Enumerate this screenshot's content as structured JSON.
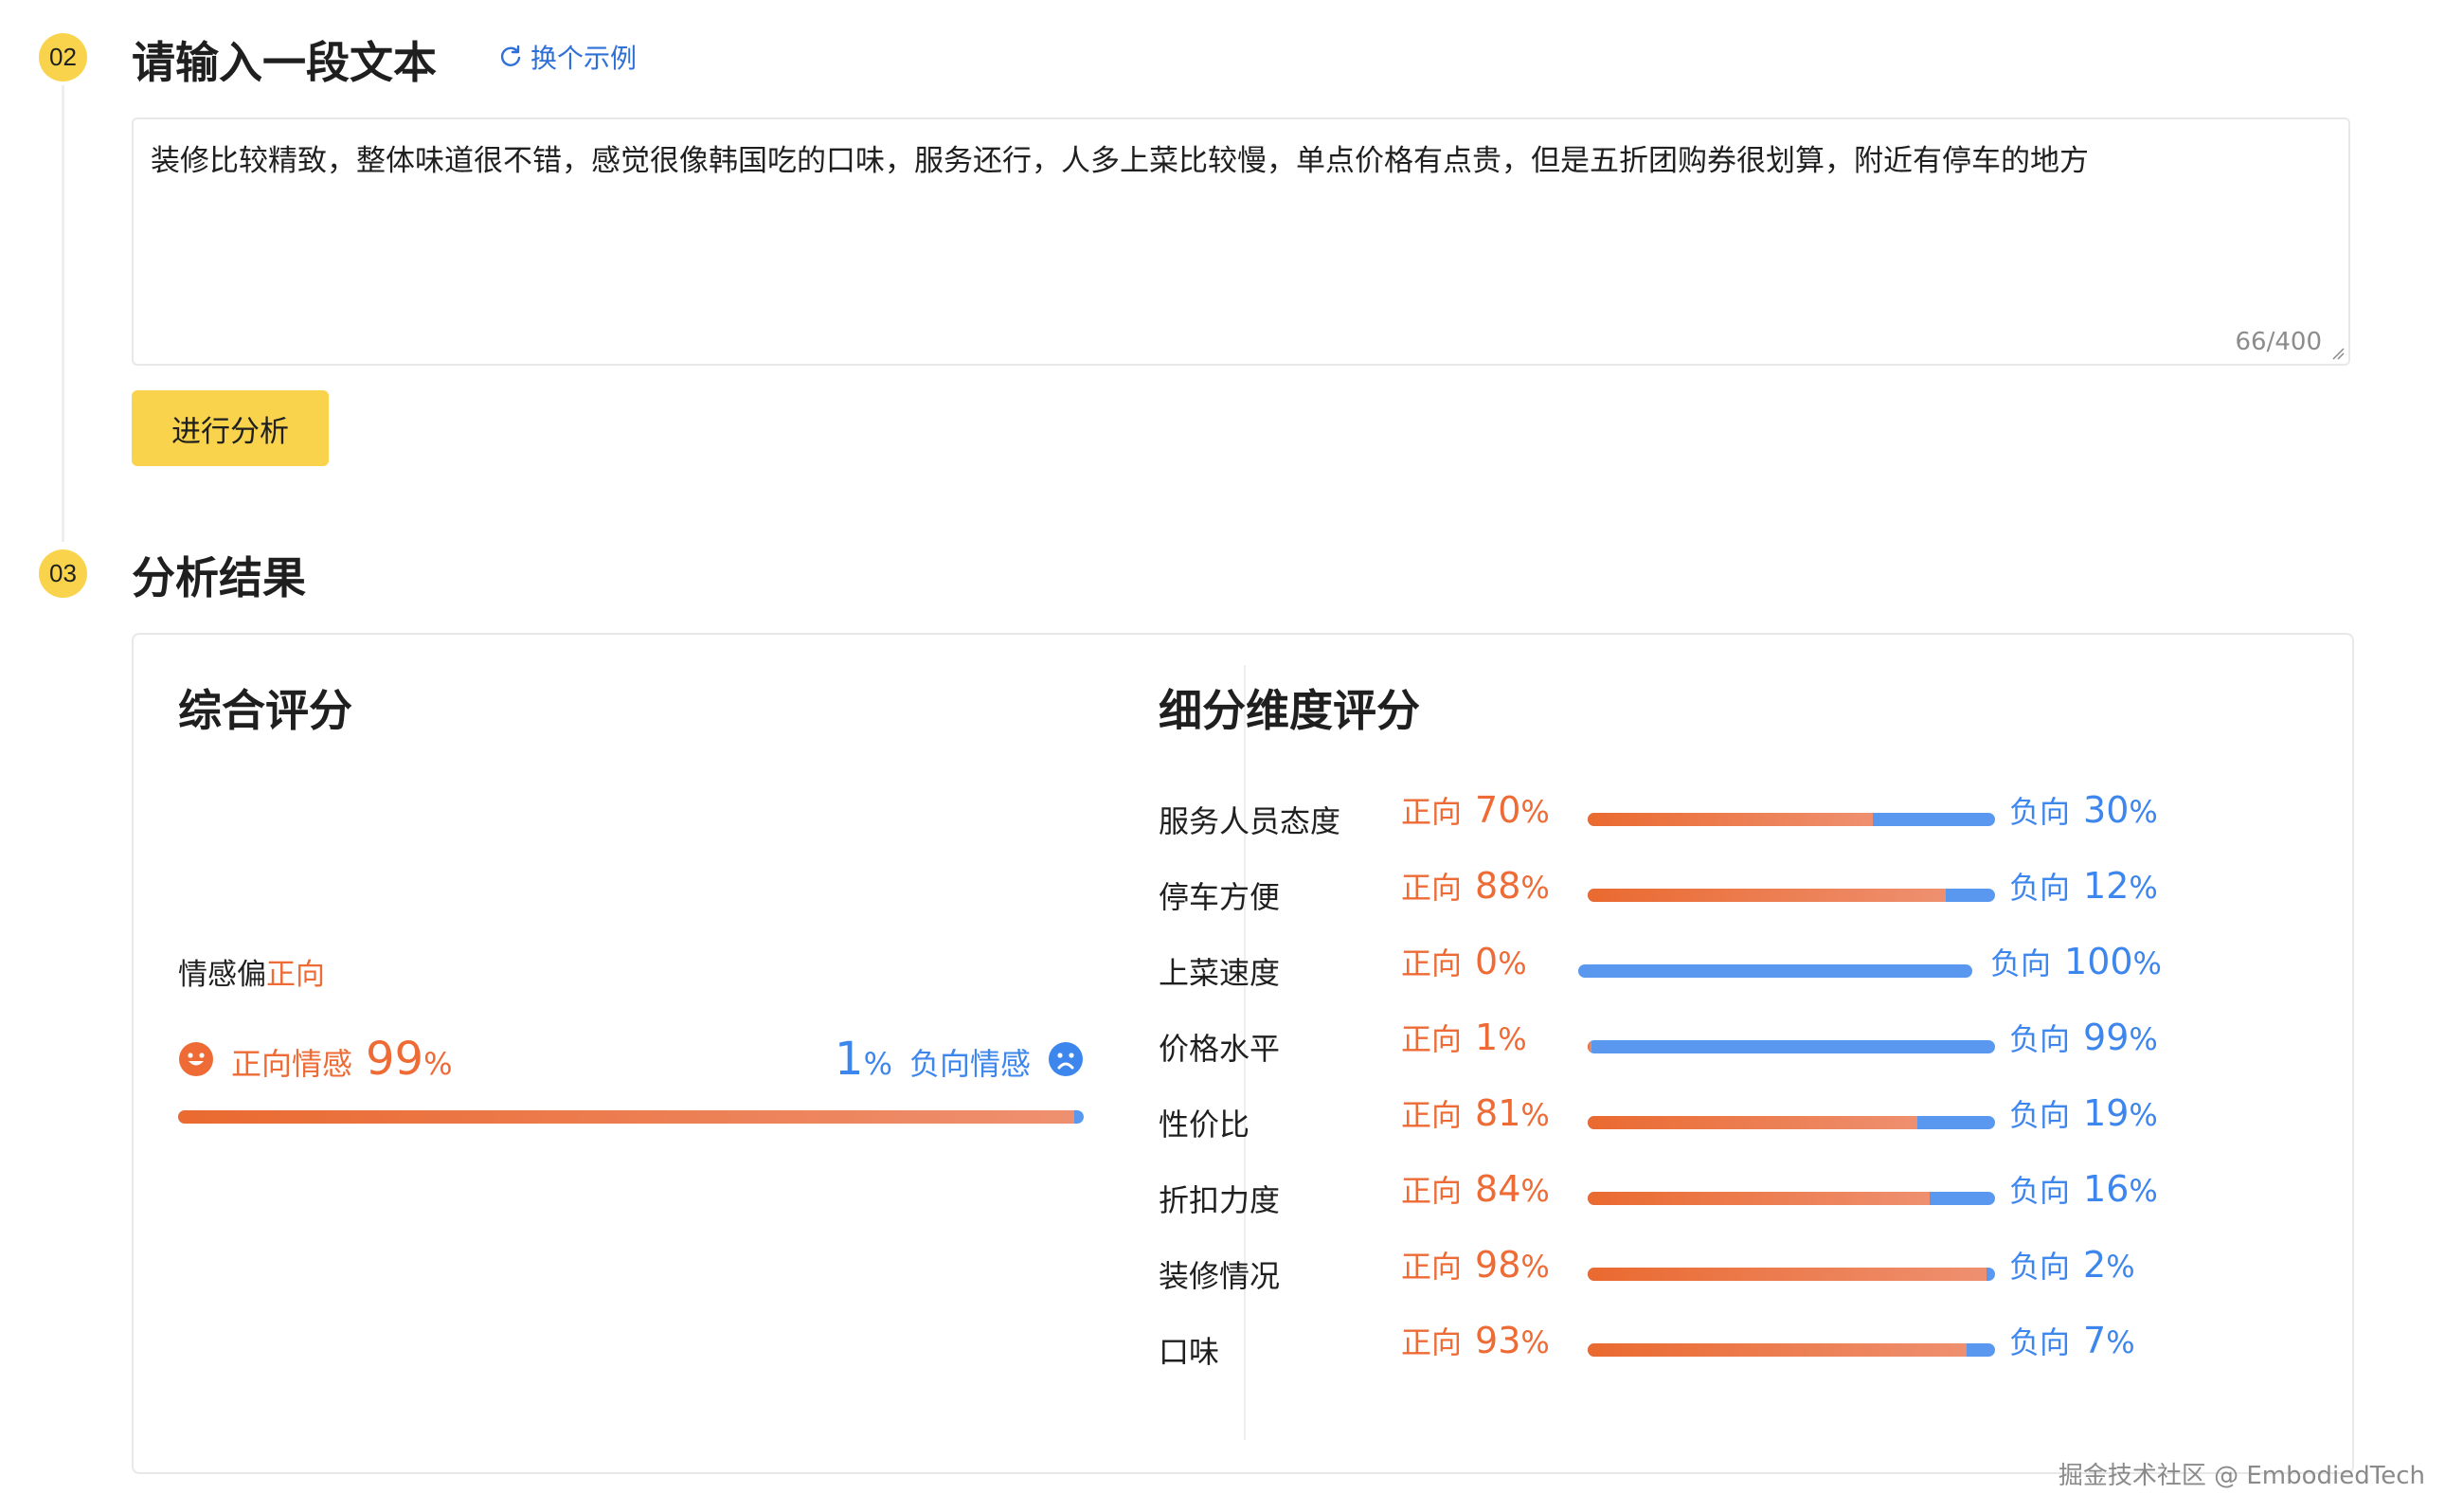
{
  "step_input": {
    "number": "02",
    "title": "请输入一段文本",
    "example_link": "换个示例",
    "text": "装修比较精致，整体味道很不错，感觉很像韩国吃的口味，服务还行，人多上菜比较慢，单点价格有点贵，但是五折团购券很划算，附近有停车的地方",
    "char_count": "66/400",
    "analyze_button": "进行分析"
  },
  "step_result": {
    "number": "03",
    "title": "分析结果"
  },
  "overall": {
    "title": "综合评分",
    "tendency_prefix": "情感偏",
    "tendency_value": "正向",
    "positive_label": "正向情感",
    "positive_value": "99",
    "positive_pct": 99,
    "negative_label": "负向情感",
    "negative_value": "1",
    "negative_pct": 1,
    "percent_sign": "%"
  },
  "dimensions": {
    "title": "细分维度评分",
    "positive_label": "正向",
    "negative_label": "负向",
    "percent_sign": "%",
    "items": [
      {
        "name": "服务人员态度",
        "positive": "70",
        "negative": "30",
        "pos_pct": 70
      },
      {
        "name": "停车方便",
        "positive": "88",
        "negative": "12",
        "pos_pct": 88
      },
      {
        "name": "上菜速度",
        "positive": "0",
        "negative": "100",
        "pos_pct": 0
      },
      {
        "name": "价格水平",
        "positive": "1",
        "negative": "99",
        "pos_pct": 1
      },
      {
        "name": "性价比",
        "positive": "81",
        "negative": "19",
        "pos_pct": 81
      },
      {
        "name": "折扣力度",
        "positive": "84",
        "negative": "16",
        "pos_pct": 84
      },
      {
        "name": "装修情况",
        "positive": "98",
        "negative": "2",
        "pos_pct": 98
      },
      {
        "name": "口味",
        "positive": "93",
        "negative": "7",
        "pos_pct": 93
      }
    ]
  },
  "colors": {
    "accent_yellow": "#f9d34b",
    "positive": "#ee6b35",
    "negative": "#3d86ee",
    "link": "#2f6fd8"
  },
  "watermark": "掘金技术社区 @ EmbodiedTech"
}
